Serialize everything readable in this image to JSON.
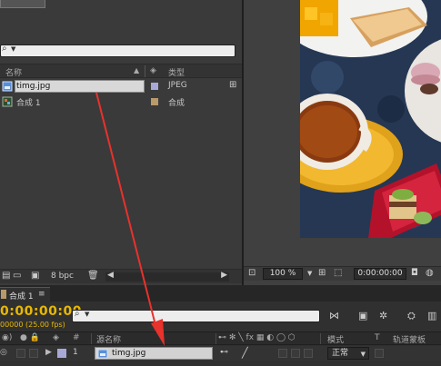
{
  "project": {
    "search_icon": "magnifier-icon",
    "headers": {
      "name": "名称",
      "type": "类型"
    },
    "items": [
      {
        "name": "timg.jpg",
        "type": "JPEG",
        "icon": "image-file-icon",
        "label_color": "#a8a8d6"
      },
      {
        "name": "合成 1",
        "type": "合成",
        "icon": "composition-icon",
        "label_color": "#b99a6a"
      }
    ],
    "footer": {
      "bpc": "8 bpc"
    }
  },
  "viewer": {
    "zoom": "100 %",
    "timecode": "0:00:00:00"
  },
  "timeline": {
    "tab_label": "合成 1",
    "tab_close": "≡",
    "timecode": "0:00:00:00",
    "fps": "00000 (25.00 fps)",
    "headers": {
      "index": "#",
      "source_name": "源名称",
      "mode": "模式",
      "t": "T",
      "trkmat": "轨道蒙板"
    },
    "layer": {
      "index": "1",
      "name": "timg.jpg",
      "mode": "正常"
    }
  },
  "colors": {
    "timecode": "#e8b800",
    "arrow": "#e8322c"
  }
}
